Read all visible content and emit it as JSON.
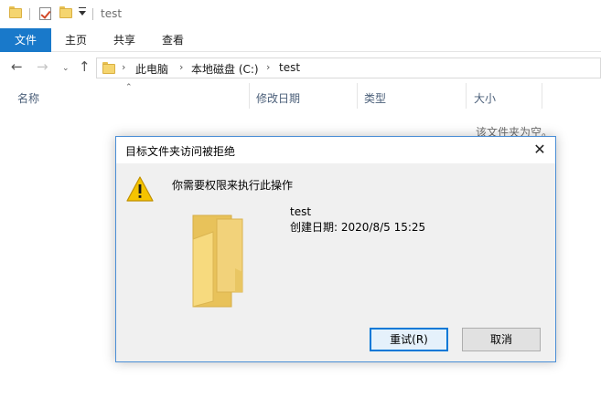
{
  "window": {
    "title": "test"
  },
  "ribbon": {
    "tabs": [
      "文件",
      "主页",
      "共享",
      "查看"
    ]
  },
  "address": {
    "crumbs": [
      "此电脑",
      "本地磁盘 (C:)",
      "test"
    ]
  },
  "columns": {
    "name": "名称",
    "modified": "修改日期",
    "type": "类型",
    "size": "大小"
  },
  "content": {
    "empty_message": "该文件夹为空。"
  },
  "dialog": {
    "title": "目标文件夹访问被拒绝",
    "message": "你需要权限来执行此操作",
    "file_name": "test",
    "created": "创建日期: 2020/8/5 15:25",
    "retry_label": "重试(R)",
    "cancel_label": "取消"
  },
  "colors": {
    "accent": "#1979ca",
    "folder": "#f5d56f",
    "warning": "#f5c400"
  }
}
